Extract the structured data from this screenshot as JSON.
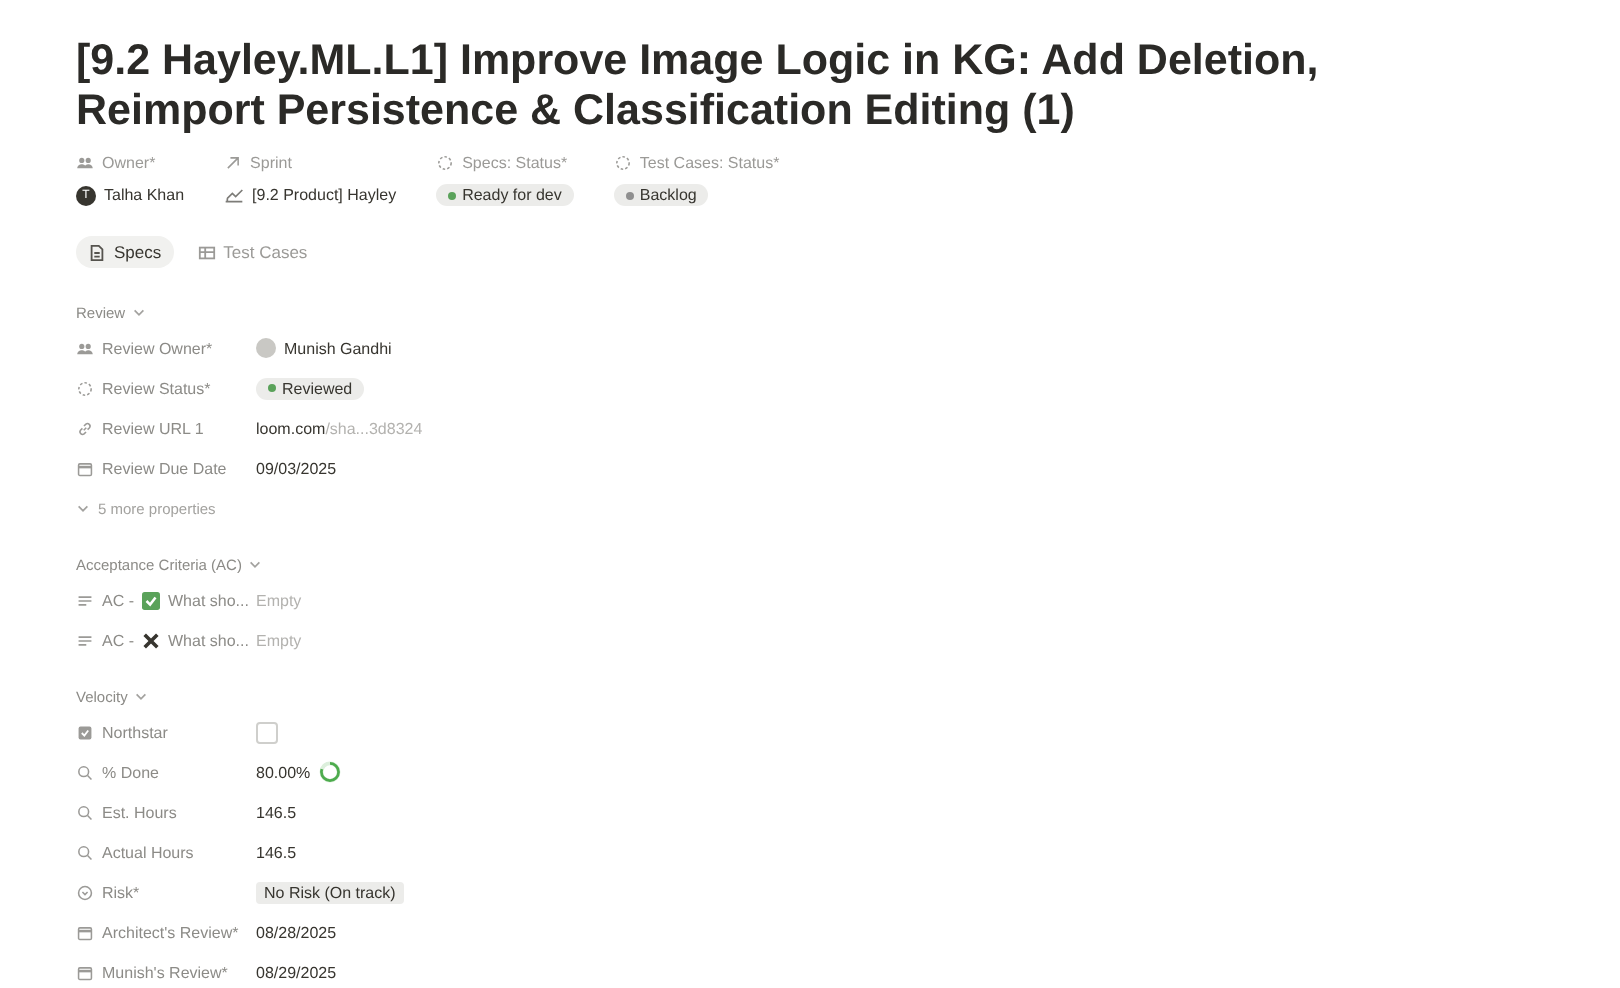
{
  "title": "[9.2 Hayley.ML.L1] Improve Image Logic in KG: Add Deletion,  Reimport Persistence & Classification Editing (1)",
  "header_properties": [
    {
      "kind": "person",
      "label": "Owner*",
      "value": "Talha Khan",
      "avatar": "T"
    },
    {
      "kind": "relation",
      "label": "Sprint",
      "value": "[9.2 Product] Hayley"
    },
    {
      "kind": "status",
      "label": "Specs: Status*",
      "value": "Ready for dev",
      "color": "#5aa25a"
    },
    {
      "kind": "status",
      "label": "Test Cases: Status*",
      "value": "Backlog",
      "color": "#8f8f8f"
    }
  ],
  "tabs": [
    {
      "label": "Specs",
      "kind": "doc",
      "selected": true
    },
    {
      "label": "Test Cases",
      "kind": "table",
      "selected": false
    }
  ],
  "sections": [
    {
      "title": "Review",
      "rows": [
        {
          "kind": "person",
          "label": "Review Owner*",
          "value": "Munish Gandhi"
        },
        {
          "kind": "status",
          "label": "Review Status*",
          "value": "Reviewed",
          "color": "#5aa25a"
        },
        {
          "kind": "url",
          "label": "Review URL 1",
          "host": "loom.com",
          "path": "/sha...3d8324"
        },
        {
          "kind": "date",
          "label": "Review Due Date",
          "value": "09/03/2025"
        },
        {
          "kind": "more",
          "label": "5 more properties"
        }
      ]
    },
    {
      "title": "Acceptance Criteria (AC)",
      "rows": [
        {
          "kind": "text",
          "prefix": "AC -",
          "emoji": {
            "kind": "check"
          },
          "label": "What sho...",
          "value": "Empty"
        },
        {
          "kind": "text",
          "prefix": "AC -",
          "emoji": {
            "kind": "cross"
          },
          "label": "What sho...",
          "value": "Empty"
        }
      ]
    },
    {
      "title": "Velocity",
      "rows": [
        {
          "kind": "checkbox",
          "label": "Northstar",
          "checked": false
        },
        {
          "kind": "formula",
          "label": "% Done",
          "value": "80.00%",
          "level": 0.8
        },
        {
          "kind": "formula",
          "label": "Est. Hours",
          "value": "146.5"
        },
        {
          "kind": "formula",
          "label": "Actual Hours",
          "value": "146.5"
        },
        {
          "kind": "select",
          "label": "Risk*",
          "value": "No Risk (On track)"
        },
        {
          "kind": "date",
          "label": "Architect's Review*",
          "value": "08/28/2025"
        },
        {
          "kind": "date",
          "label": "Munish's Review*",
          "value": "08/29/2025"
        }
      ]
    }
  ]
}
